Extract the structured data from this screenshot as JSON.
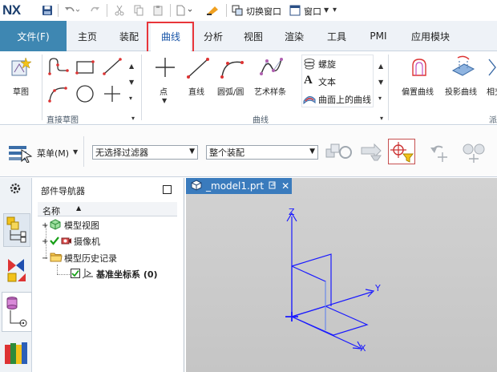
{
  "app": {
    "logo": "NX",
    "quick_access": {
      "switch_window": "切换窗口",
      "window_menu": "窗口"
    }
  },
  "menu": {
    "file": "文件(F)",
    "tabs": [
      "主页",
      "装配",
      "曲线",
      "分析",
      "视图",
      "渲染",
      "工具",
      "PMI",
      "应用模块"
    ],
    "active_tab": "曲线"
  },
  "ribbon": {
    "sketch": "草图",
    "group_direct_sketch": "直接草图",
    "point": "点",
    "line": "直线",
    "arc_circle": "圆弧/圆",
    "studio_spline": "艺术样条",
    "helix": "螺旋",
    "text": "文本",
    "curve_on_surface": "曲面上的曲线",
    "group_curve": "曲线",
    "offset_curve": "偏置曲线",
    "projected_curve": "投影曲线",
    "partial_3": "相交",
    "partial_group": "派"
  },
  "toolbar": {
    "menu_button": "菜单(M)",
    "filter_value": "无选择过滤器",
    "scope_value": "整个装配"
  },
  "navigator": {
    "title": "部件导航器",
    "column_name": "名称",
    "items": [
      "模型视图",
      "摄像机",
      "模型历史记录",
      "基准坐标系 (0)"
    ]
  },
  "viewport": {
    "tab_label": "_model1.prt",
    "axis_x": "X",
    "axis_y": "Y",
    "axis_z": "Z"
  },
  "colors": {
    "file_tab": "#3e87b2",
    "highlight": "#e8353a",
    "viewport_tab": "#3a7bbd",
    "datum_blue": "#1a1aff"
  }
}
